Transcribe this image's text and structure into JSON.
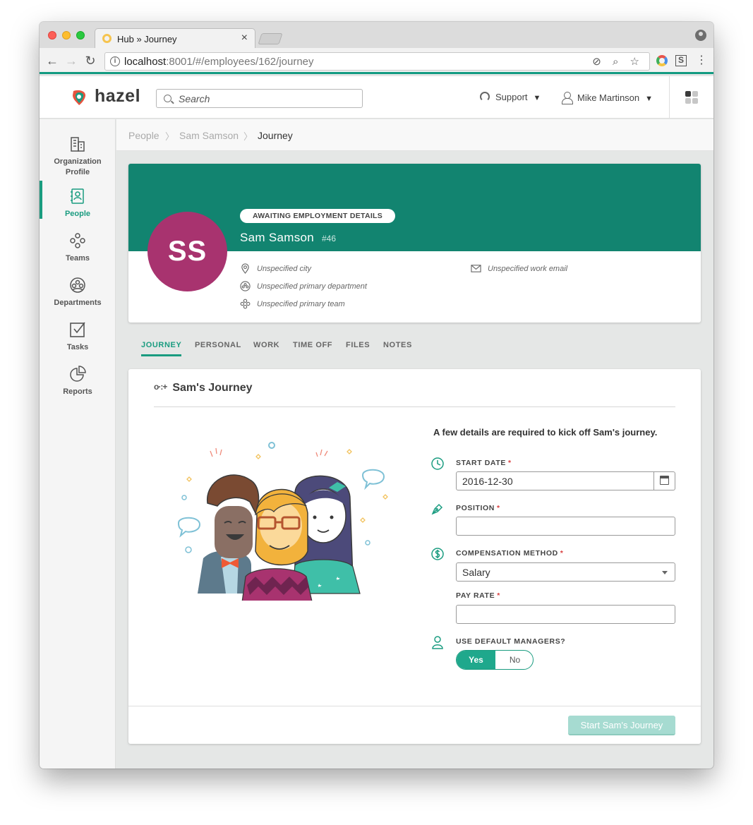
{
  "browser": {
    "tab_title": "Hub » Journey",
    "tab_close": "×",
    "url_host": "localhost",
    "url_rest": ":8001/#/employees/162/journey",
    "url_icons": "⊘ ⌕ ☆",
    "ext_s": "S",
    "menu": "⋮",
    "back": "←",
    "forward": "→",
    "reload": "↻",
    "info": "i"
  },
  "header": {
    "logo_text": "hazel",
    "search_placeholder": "Search",
    "support_label": "Support",
    "user_name": "Mike Martinson",
    "caret": "▼"
  },
  "sidebar": {
    "items": [
      {
        "label_line1": "Organization",
        "label_line2": "Profile",
        "icon": "building-icon"
      },
      {
        "label_line1": "People",
        "icon": "address-book-icon"
      },
      {
        "label_line1": "Teams",
        "icon": "teams-icon"
      },
      {
        "label_line1": "Departments",
        "icon": "departments-icon"
      },
      {
        "label_line1": "Tasks",
        "icon": "checkbox-icon"
      },
      {
        "label_line1": "Reports",
        "icon": "pie-chart-icon"
      }
    ]
  },
  "breadcrumb": {
    "items": [
      "People",
      "Sam Samson",
      "Journey"
    ],
    "sep": "〉"
  },
  "profile": {
    "status": "AWAITING EMPLOYMENT DETAILS",
    "name": "Sam Samson",
    "id": "#46",
    "initials": "SS",
    "city": "Unspecified city",
    "department": "Unspecified primary department",
    "team": "Unspecified primary team",
    "work_email": "Unspecified work email",
    "avatar_color": "#a8336f",
    "banner_color": "#128470"
  },
  "tabs": [
    "JOURNEY",
    "PERSONAL",
    "WORK",
    "TIME OFF",
    "FILES",
    "NOTES"
  ],
  "journey": {
    "icon_glyph": "o·:+",
    "title": "Sam's Journey",
    "intro": "A few details are required to kick off Sam's journey.",
    "start_date_label": "START DATE",
    "start_date_value": "2016-12-30",
    "position_label": "POSITION",
    "position_value": "",
    "comp_label": "COMPENSATION METHOD",
    "comp_value": "Salary",
    "pay_rate_label": "PAY RATE",
    "pay_rate_value": "",
    "default_mgr_label": "USE DEFAULT MANAGERS?",
    "yes_label": "Yes",
    "no_label": "No",
    "required_mark": "*",
    "start_button": "Start Sam's Journey",
    "accent_color": "#1a9c80"
  }
}
